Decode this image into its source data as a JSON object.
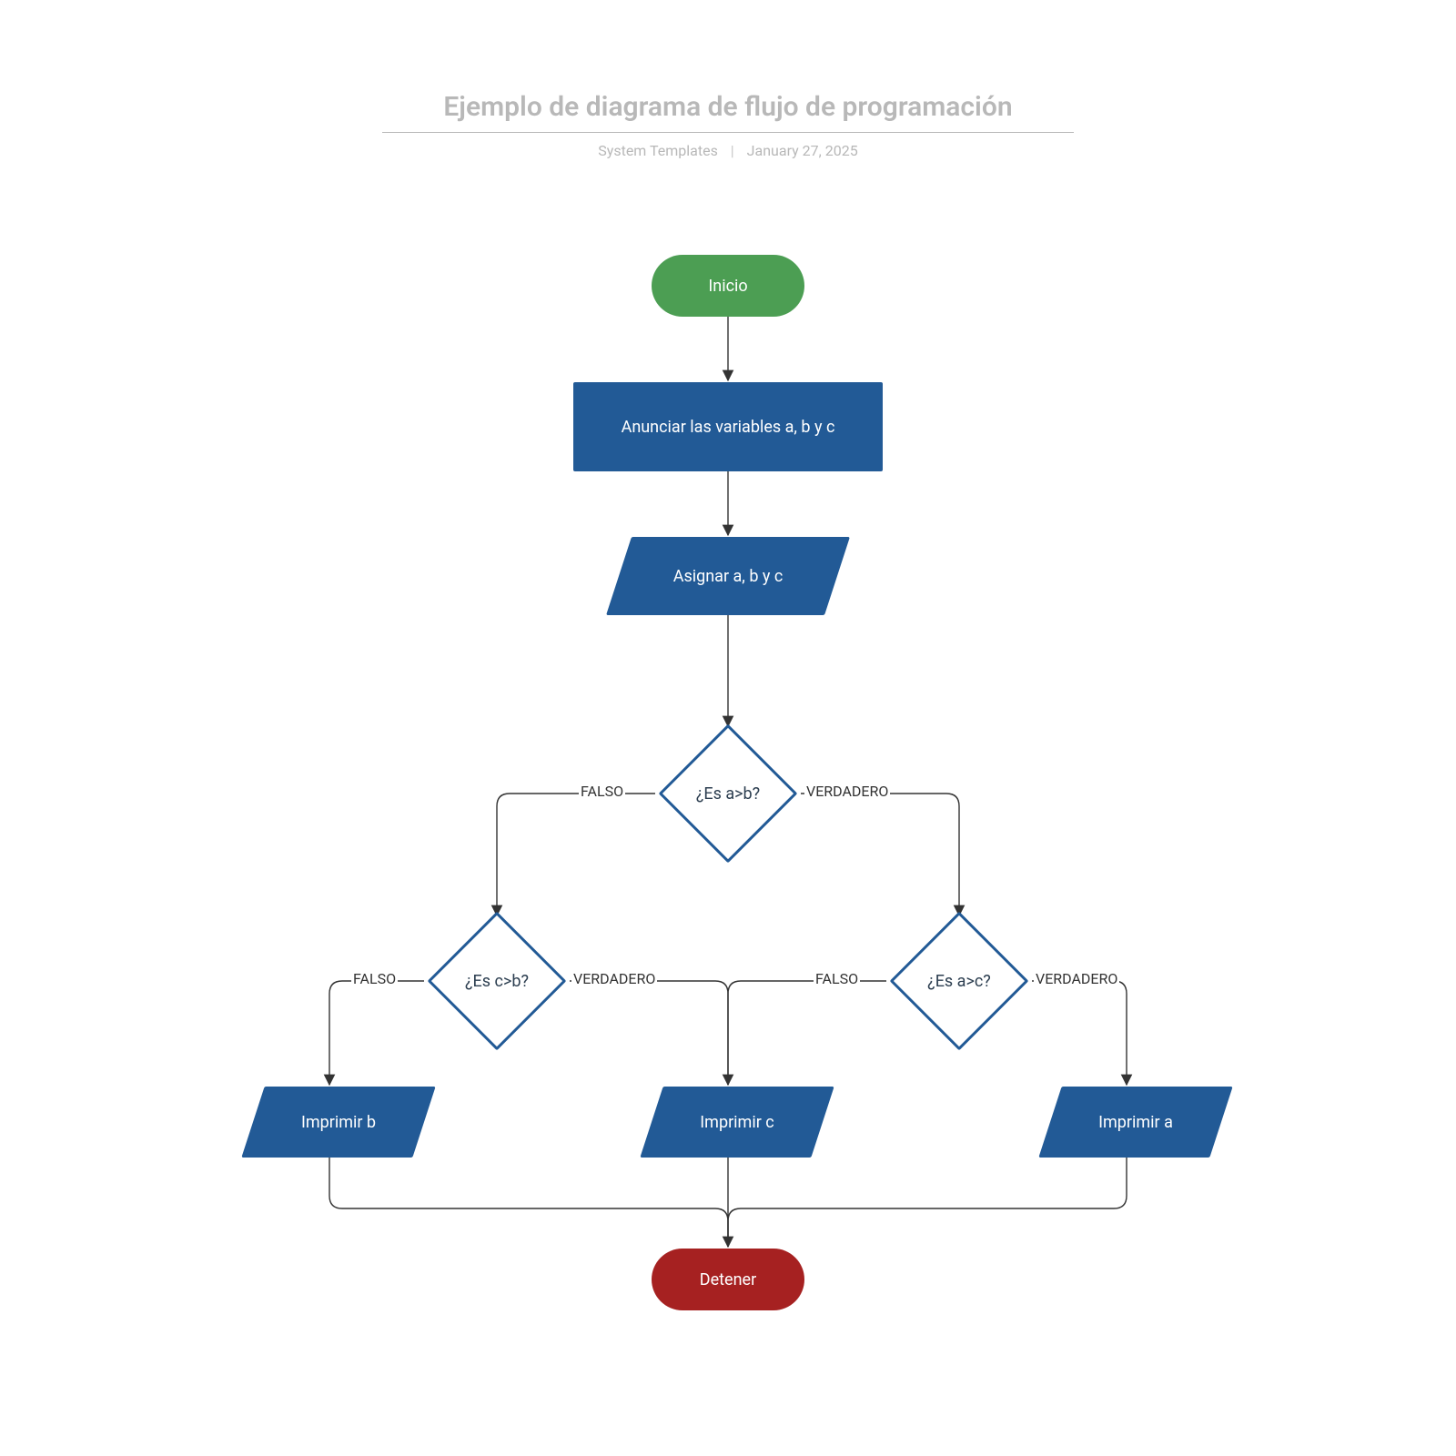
{
  "header": {
    "title": "Ejemplo de diagrama de flujo de programación",
    "author": "System Templates",
    "date": "January 27, 2025"
  },
  "nodes": {
    "start": "Inicio",
    "declare": "Anunciar las variables a, b y c",
    "assign": "Asignar a, b y c",
    "dec_ab": "¿Es a>b?",
    "dec_cb": "¿Es c>b?",
    "dec_ac": "¿Es a>c?",
    "print_b": "Imprimir b",
    "print_c": "Imprimir c",
    "print_a": "Imprimir a",
    "stop": "Detener"
  },
  "labels": {
    "true": "VERDADERO",
    "false": "FALSO"
  },
  "colors": {
    "start": "#4c9e53",
    "process": "#225a96",
    "stop": "#a62121",
    "text_muted": "#b8b8b8"
  }
}
